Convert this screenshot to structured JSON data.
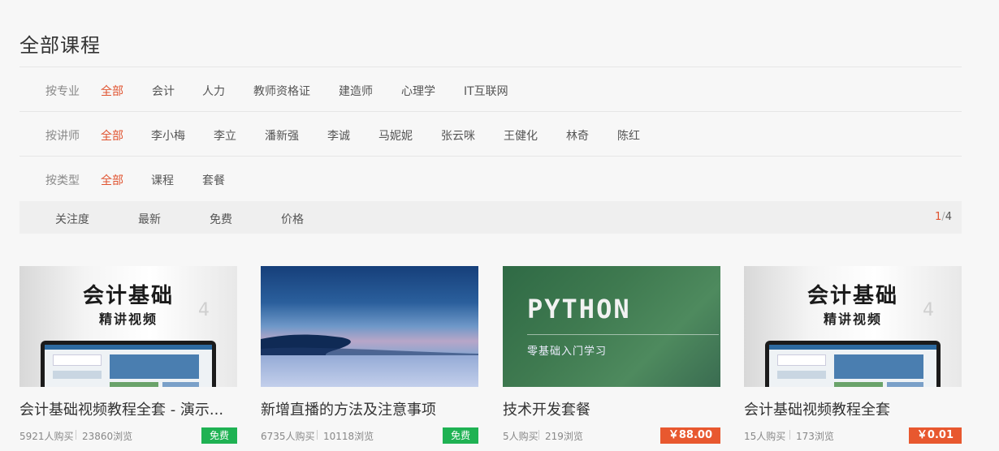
{
  "page_title": "全部课程",
  "filters": {
    "major": {
      "label": "按专业",
      "options": [
        "全部",
        "会计",
        "人力",
        "教师资格证",
        "建造师",
        "心理学",
        "IT互联网"
      ]
    },
    "teacher": {
      "label": "按讲师",
      "options": [
        "全部",
        "李小梅",
        "李立",
        "潘新强",
        "李诚",
        "马妮妮",
        "张云咪",
        "王健化",
        "林奇",
        "陈红"
      ]
    },
    "type": {
      "label": "按类型",
      "options": [
        "全部",
        "课程",
        "套餐"
      ]
    }
  },
  "sort": {
    "items": [
      "关注度",
      "最新",
      "免费",
      "价格"
    ]
  },
  "pager": {
    "current": "1",
    "separator": "/",
    "total": "4"
  },
  "courses": [
    {
      "title": "会计基础视频教程全套 - 演示...",
      "buyers": "5921人购买",
      "views": "23860浏览",
      "price": "免费",
      "thumb_big": "会计基础",
      "thumb_small": "精讲视频",
      "thumb_num": "4"
    },
    {
      "title": "新增直播的方法及注意事项",
      "buyers": "6735人购买",
      "views": "10118浏览",
      "price": "免费"
    },
    {
      "title": "技术开发套餐",
      "buyers": "5人购买",
      "views": "219浏览",
      "price": "￥88.00",
      "thumb_big": "PYTHON",
      "thumb_small": "零基础入门学习"
    },
    {
      "title": "会计基础视频教程全套",
      "buyers": "15人购买",
      "views": "173浏览",
      "price": "￥0.01",
      "thumb_big": "会计基础",
      "thumb_small": "精讲视频",
      "thumb_num": "4"
    }
  ],
  "colors": {
    "accent": "#e0532f",
    "free_badge": "#1fb253",
    "price_badge": "#e8582f"
  }
}
